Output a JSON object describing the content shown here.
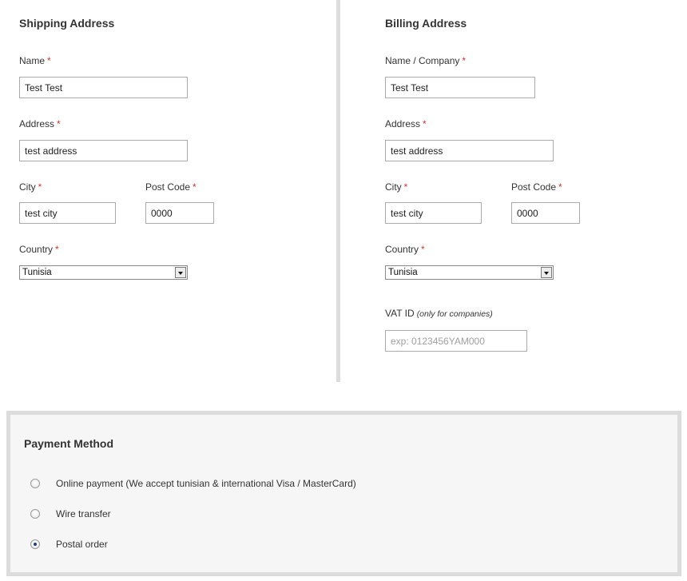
{
  "shipping": {
    "title": "Shipping Address",
    "required_mark": "*",
    "name_label": "Name",
    "name_value": "Test Test",
    "address_label": "Address",
    "address_value": "test address",
    "city_label": "City",
    "city_value": "test city",
    "postcode_label": "Post Code",
    "postcode_value": "0000",
    "country_label": "Country",
    "country_value": "Tunisia"
  },
  "billing": {
    "title": "Billing Address",
    "required_mark": "*",
    "name_label": "Name / Company",
    "name_value": "Test Test",
    "address_label": "Address",
    "address_value": "test address",
    "city_label": "City",
    "city_value": "test city",
    "postcode_label": "Post Code",
    "postcode_value": "0000",
    "country_label": "Country",
    "country_value": "Tunisia",
    "vat_label": "VAT ID",
    "vat_hint": "(only for companies)",
    "vat_placeholder": "exp: 0123456YAM000"
  },
  "payment": {
    "title": "Payment Method",
    "options": [
      {
        "label": "Online payment (We accept tunisian & international Visa / MasterCard)",
        "checked": false
      },
      {
        "label": "Wire transfer",
        "checked": false
      },
      {
        "label": "Postal order",
        "checked": true
      }
    ]
  },
  "colors": {
    "required": "#d9372b",
    "divider": "#dcdcdc",
    "panel_bg": "#f6f6f6",
    "text": "#333333"
  }
}
